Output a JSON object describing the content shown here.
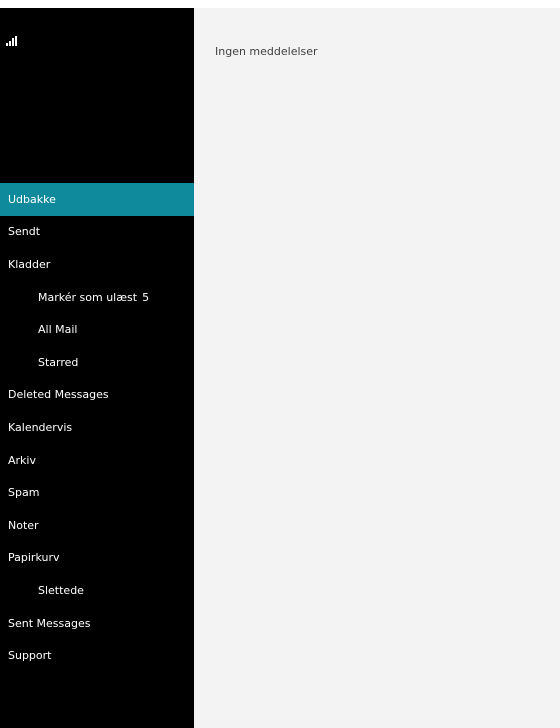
{
  "sidebar": {
    "status_icon": "signal-bars-icon",
    "folders": [
      {
        "label": "Udbakke",
        "count": "",
        "active": true,
        "sub": false
      },
      {
        "label": "Sendt",
        "count": "",
        "active": false,
        "sub": false
      },
      {
        "label": "Kladder",
        "count": "",
        "active": false,
        "sub": false
      },
      {
        "label": "Markér som ulæst",
        "count": "5",
        "active": false,
        "sub": true
      },
      {
        "label": "All Mail",
        "count": "",
        "active": false,
        "sub": true
      },
      {
        "label": "Starred",
        "count": "",
        "active": false,
        "sub": true
      },
      {
        "label": "Deleted Messages",
        "count": "",
        "active": false,
        "sub": false
      },
      {
        "label": "Kalendervis",
        "count": "",
        "active": false,
        "sub": false
      },
      {
        "label": "Arkiv",
        "count": "",
        "active": false,
        "sub": false
      },
      {
        "label": "Spam",
        "count": "",
        "active": false,
        "sub": false
      },
      {
        "label": "Noter",
        "count": "",
        "active": false,
        "sub": false
      },
      {
        "label": "Papirkurv",
        "count": "",
        "active": false,
        "sub": false
      },
      {
        "label": "Slettede",
        "count": "",
        "active": false,
        "sub": true
      },
      {
        "label": "Sent Messages",
        "count": "",
        "active": false,
        "sub": false
      },
      {
        "label": "Support",
        "count": "",
        "active": false,
        "sub": false
      }
    ]
  },
  "content": {
    "empty_message": "Ingen meddelelser"
  },
  "colors": {
    "sidebar_bg": "#000000",
    "active_item": "#0f8a9d",
    "content_bg": "#f3f3f3"
  }
}
